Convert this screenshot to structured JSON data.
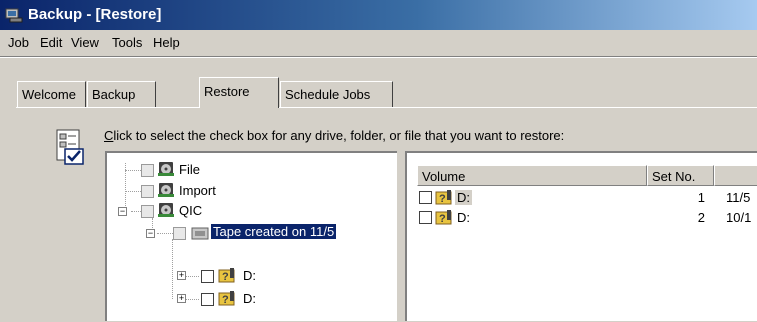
{
  "window": {
    "title": "Backup - [Restore]"
  },
  "menu": [
    "Job",
    "Edit",
    "View",
    "Tools",
    "Help"
  ],
  "tabs": [
    "Welcome",
    "Backup",
    "Restore",
    "Schedule Jobs"
  ],
  "active_tab": "Restore",
  "instruction": {
    "accel": "C",
    "rest": "lick to select the check box for any drive, folder, or file that you want to restore:"
  },
  "tree": {
    "nodes": [
      "File",
      "Import",
      "QIC",
      "Tape created on 11/5",
      "D:",
      "D:"
    ]
  },
  "list": {
    "columns": [
      "Volume",
      "Set No.",
      ""
    ],
    "rows": [
      {
        "volume": "D:",
        "set_no": "1",
        "date": "11/5"
      },
      {
        "volume": "D:",
        "set_no": "2",
        "date": "10/1"
      }
    ]
  },
  "icons": [
    "app-backup-icon",
    "restore-wizard-icon",
    "media-icon",
    "tape-icon",
    "drive-question-icon",
    "checkbox"
  ],
  "colors": {
    "title_bar": "#0a246a",
    "selection": "#0a246a",
    "face": "#d4d0c8"
  }
}
